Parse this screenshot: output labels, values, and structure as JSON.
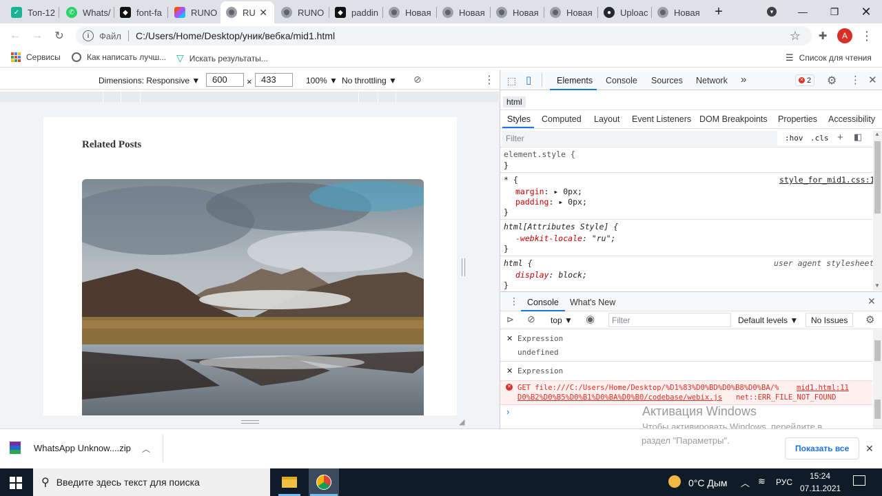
{
  "tabs": [
    {
      "label": "Топ-12",
      "icon": "ttb-icon"
    },
    {
      "label": "Whats/",
      "icon": "whatsapp-icon"
    },
    {
      "label": "font-fa",
      "icon": "github-page-icon"
    },
    {
      "label": "RUNO",
      "icon": "figma-icon"
    },
    {
      "label": "RU",
      "icon": "chrome-icon"
    },
    {
      "label": "RUNO",
      "icon": "chrome-icon"
    },
    {
      "label": "paddin",
      "icon": "github-page-icon"
    },
    {
      "label": "Новая",
      "icon": "chrome-icon"
    },
    {
      "label": "Новая",
      "icon": "chrome-icon"
    },
    {
      "label": "Новая",
      "icon": "chrome-icon"
    },
    {
      "label": "Новая",
      "icon": "chrome-icon"
    },
    {
      "label": "Uploac",
      "icon": "github-icon"
    },
    {
      "label": "Новая",
      "icon": "chrome-icon"
    }
  ],
  "new_tab": "+",
  "address": {
    "scheme_label": "Файл",
    "url": "C:/Users/Home/Desktop/уник/вебка/mid1.html"
  },
  "avatar_letter": "A",
  "bookmarks": {
    "apps": "Сервисы",
    "items": [
      "Как написать лучш...",
      "Искать результаты..."
    ],
    "reading_list": "Список для чтения"
  },
  "device_toolbar": {
    "dimensions": "Dimensions: Responsive ▼",
    "width": "600",
    "times": "×",
    "height": "433",
    "zoom": "100% ▼",
    "throttle": "No throttling ▼"
  },
  "page": {
    "heading": "Related Posts"
  },
  "devtools": {
    "tabs": [
      "Elements",
      "Console",
      "Sources",
      "Network"
    ],
    "more": "»",
    "error_count": "2",
    "breadcrumb": "html",
    "subtabs": [
      "Styles",
      "Computed",
      "Layout",
      "Event Listeners",
      "DOM Breakpoints",
      "Properties",
      "Accessibility"
    ],
    "filter_placeholder": "Filter",
    "hov": ":hov",
    "cls": ".cls",
    "rules": {
      "r1_sel": "element.style {",
      "r1_end": "}",
      "r2_sel": "* {",
      "r2_src": "style_for_mid1.css:1",
      "r2_p1": "margin",
      "r2_v1": "0px;",
      "r2_p2": "padding",
      "r2_v2": "0px;",
      "r2_end": "}",
      "r3_sel": "html[Attributes Style] {",
      "r3_p1": "-webkit-locale",
      "r3_v1": "\"ru\";",
      "r3_end": "}",
      "r4_sel": "html {",
      "r4_src": "user agent stylesheet",
      "r4_p1": "display",
      "r4_v1": "block;",
      "r4_end": "}"
    },
    "drawer_tabs": [
      "Console",
      "What's New"
    ],
    "context": "top",
    "console_filter": "Filter",
    "levels": "Default levels ▼",
    "issues": "No Issues",
    "expr1_label": "Expression",
    "expr1_value": "undefined",
    "expr2_label": "Expression",
    "error_line1": "GET file:///C:/Users/Home/Desktop/%D1%83%D0%BD%D0%B8%D0%BA/%",
    "error_source": "mid1.html:11",
    "error_line2": "D0%B2%D0%B5%D0%B1%D0%BA%D0%B0/codebase/webix.js",
    "error_code": "net::ERR_FILE_NOT_FOUND",
    "prompt": "›"
  },
  "watermark": {
    "title": "Активация Windows",
    "line1": "Чтобы активировать Windows, перейдите в",
    "line2": "раздел \"Параметры\"."
  },
  "download": {
    "file": "WhatsApp Unknow....zip",
    "show_all": "Показать все"
  },
  "taskbar": {
    "search": "Введите здесь текст для поиска",
    "weather": "0°C Дым",
    "lang": "РУС",
    "time": "15:24",
    "date": "07.11.2021"
  },
  "colors": {
    "accent": "#1a73e8",
    "error": "#d93025",
    "taskbar": "#101b28"
  }
}
